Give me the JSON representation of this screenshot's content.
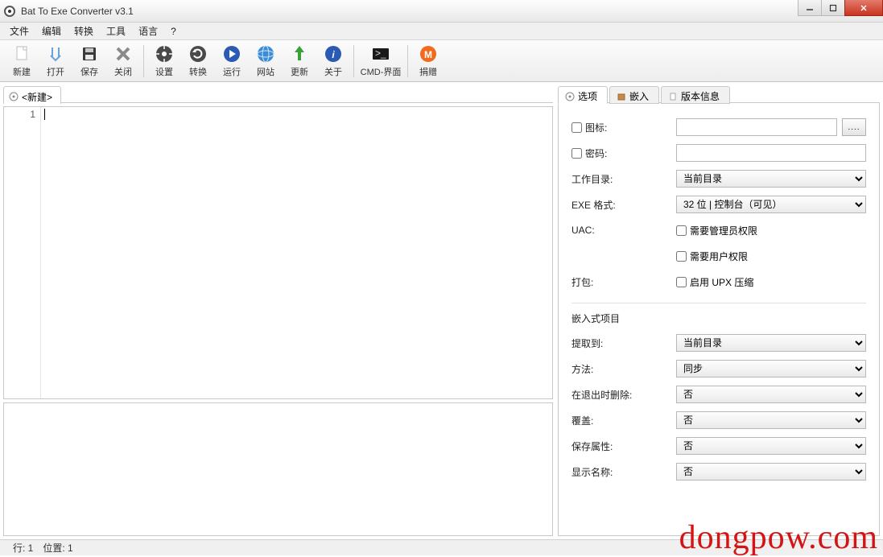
{
  "window": {
    "title": "Bat To Exe Converter v3.1"
  },
  "menu": {
    "file": "文件",
    "edit": "编辑",
    "convert": "转换",
    "tools": "工具",
    "language": "语言",
    "help": "?"
  },
  "toolbar": {
    "new": "新建",
    "open": "打开",
    "save": "保存",
    "close": "关闭",
    "settings": "设置",
    "convert": "转换",
    "run": "运行",
    "website": "网站",
    "update": "更新",
    "about": "关于",
    "cmd": "CMD-界面",
    "donate": "捐赠"
  },
  "editor": {
    "tab": "<新建>",
    "line1": "1"
  },
  "rightTabs": {
    "options": "选项",
    "embed": "嵌入",
    "version": "版本信息"
  },
  "options": {
    "icon": "图标:",
    "password": "密码:",
    "workdir": "工作目录:",
    "workdir_val": "当前目录",
    "exeformat": "EXE 格式:",
    "exeformat_val": "32 位 | 控制台（可见）",
    "uac": "UAC:",
    "uac_admin": "需要管理员权限",
    "uac_user": "需要用户权限",
    "pack": "打包:",
    "pack_upx": "启用 UPX 压缩"
  },
  "embed": {
    "header": "嵌入式项目",
    "extract_to": "提取到:",
    "extract_to_val": "当前目录",
    "method": "方法:",
    "method_val": "同步",
    "del_on_exit": "在退出时删除:",
    "del_on_exit_val": "否",
    "overwrite": "覆盖:",
    "overwrite_val": "否",
    "preserve_attr": "保存属性:",
    "preserve_attr_val": "否",
    "show_name": "显示名称:",
    "show_name_val": "否"
  },
  "status": {
    "line": "行: 1",
    "pos": "位置: 1"
  },
  "watermark": "dongpow.com"
}
